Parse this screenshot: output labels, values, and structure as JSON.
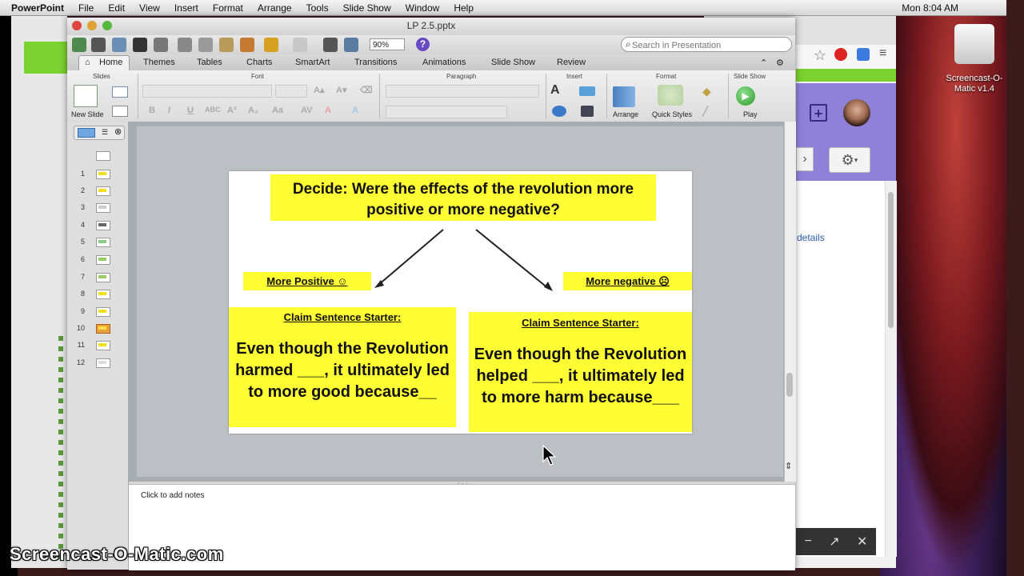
{
  "menubar": {
    "items": [
      "PowerPoint",
      "File",
      "Edit",
      "View",
      "Insert",
      "Format",
      "Arrange",
      "Tools",
      "Slide Show",
      "Window",
      "Help"
    ],
    "clock": "Mon 8:04 AM"
  },
  "window": {
    "title": "LP 2.5.pptx"
  },
  "toolbar": {
    "zoom": "90%",
    "help": "?"
  },
  "search": {
    "placeholder": "Search in Presentation"
  },
  "ribbon": {
    "tabs": [
      "Home",
      "Themes",
      "Tables",
      "Charts",
      "SmartArt",
      "Transitions",
      "Animations",
      "Slide Show",
      "Review"
    ],
    "groups": [
      "Slides",
      "Font",
      "Paragraph",
      "Insert",
      "Format",
      "Slide Show"
    ],
    "new_slide": "New Slide",
    "arrange": "Arrange",
    "quick_styles": "Quick Styles",
    "play": "Play"
  },
  "sidebar": {
    "slides": [
      "1",
      "2",
      "3",
      "4",
      "5",
      "6",
      "7",
      "8",
      "9",
      "10",
      "11",
      "12"
    ]
  },
  "slide": {
    "title": "Decide: Were the effects of the revolution more positive or more negative?",
    "left_label": "More Positive ☺",
    "right_label": "More negative ☹",
    "left_starter_heading": "Claim Sentence Starter:",
    "left_starter_body": "Even though the Revolution harmed ___, it ultimately led to more good because__",
    "right_starter_heading": "Claim Sentence Starter:",
    "right_starter_body": "Even though the Revolution helped ___, it ultimately led to more harm because___"
  },
  "notes": {
    "placeholder": "Click to add notes"
  },
  "browser": {
    "details_link": "details"
  },
  "desktop": {
    "icon_label": "Screencast-O-Matic v1.4"
  },
  "watermark": "Screencast-O-Matic.com"
}
